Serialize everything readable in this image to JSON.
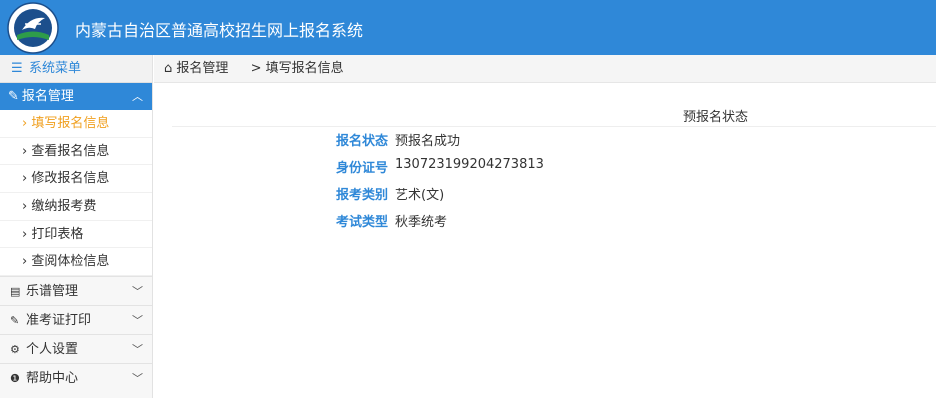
{
  "header": {
    "title": "内蒙古自治区普通高校招生网上报名系统"
  },
  "sidebar": {
    "menu_title": "系统菜单",
    "active_group": {
      "label": "报名管理",
      "icon": "edit-icon"
    },
    "sub_items": [
      {
        "label": "› 填写报名信息",
        "active": true
      },
      {
        "label": "› 查看报名信息",
        "active": false
      },
      {
        "label": "› 修改报名信息",
        "active": false
      },
      {
        "label": "› 缴纳报考费",
        "active": false
      },
      {
        "label": "› 打印表格",
        "active": false
      },
      {
        "label": "› 查阅体检信息",
        "active": false
      }
    ],
    "groups": [
      {
        "label": "乐谱管理",
        "icon": "list-icon"
      },
      {
        "label": "准考证打印",
        "icon": "edit-icon"
      },
      {
        "label": "个人设置",
        "icon": "gear-icon"
      },
      {
        "label": "帮助中心",
        "icon": "info-icon"
      }
    ]
  },
  "breadcrumb": {
    "root": "报名管理",
    "current": "> 填写报名信息"
  },
  "status_section": {
    "title": "预报名状态",
    "fields": [
      {
        "label": "报名状态",
        "value": "预报名成功"
      },
      {
        "label": "身份证号",
        "value": "130723199204273813"
      },
      {
        "label": "报考类别",
        "value": "艺术(文)"
      },
      {
        "label": "考试类型",
        "value": "秋季统考"
      }
    ]
  },
  "colors": {
    "primary": "#2f88d8",
    "active_sub": "#f0a020"
  }
}
